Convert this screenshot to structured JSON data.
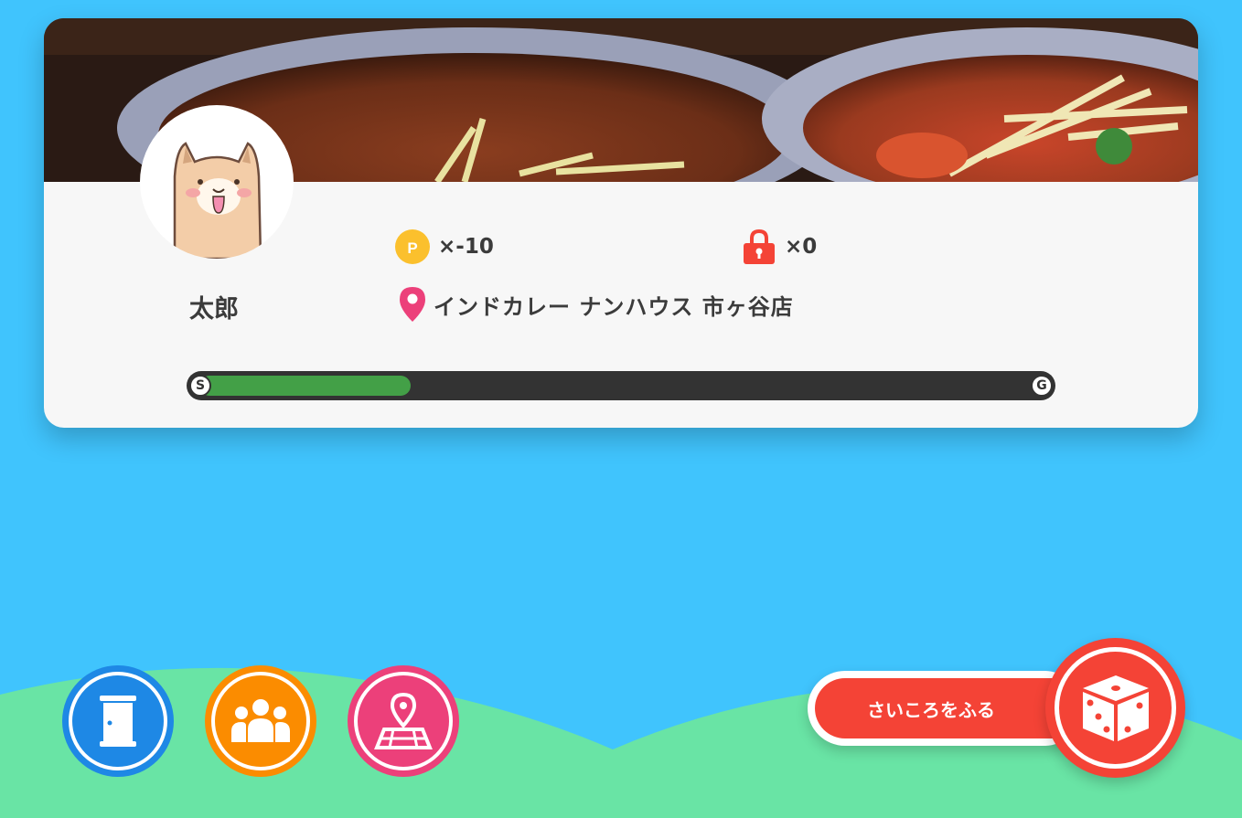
{
  "player": {
    "name": "太郎",
    "avatar_icon": "dog-avatar-icon"
  },
  "stats": {
    "points": "×-10",
    "items": "×0"
  },
  "location": {
    "name": "インドカレー ナンハウス 市ヶ谷店"
  },
  "progress": {
    "start_label": "S",
    "goal_label": "G",
    "fraction": 0.25
  },
  "actions": {
    "roll_label": "さいころをふる"
  },
  "colors": {
    "background": "#40c4fd",
    "hills": "#69e4a5",
    "door_button": "#1e88e5",
    "group_button": "#fb8c00",
    "map_button": "#ec407a",
    "roll_button": "#f44336",
    "progress_fill": "#43a047",
    "coin": "#fbc02d",
    "lock": "#f44336",
    "pin": "#ec407a"
  }
}
